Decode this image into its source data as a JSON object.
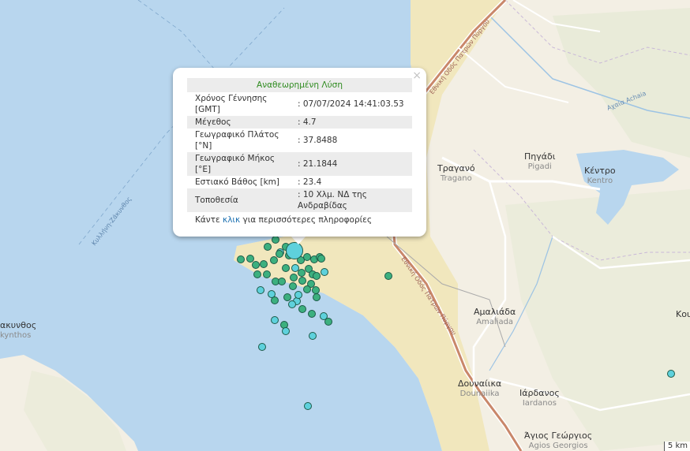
{
  "colors": {
    "sea": "#b8d6ee",
    "land": "#f3efe4",
    "plain": "#f1e7bd",
    "road": "#c9876a",
    "quake_green": "#3cb07f",
    "quake_cyan": "#5ed1dc",
    "popup_title": "#2e8b1f",
    "link": "#1a6fb0"
  },
  "popup": {
    "title": "Αναθεωρημένη Λύση",
    "close": "×",
    "rows": [
      {
        "label": "Χρόνος Γέννησης [GMT]",
        "value": ": 07/07/2024 14:41:03.53"
      },
      {
        "label": "Μέγεθος",
        "value": ": 4.7"
      },
      {
        "label": "Γεωγραφικό Πλάτος [°N]",
        "value": ": 37.8488"
      },
      {
        "label": "Γεωγραφικό Μήκος [°E]",
        "value": ": 21.1844"
      },
      {
        "label": "Εστιακό Βάθος [km]",
        "value": ": 23.4"
      },
      {
        "label": "Τοποθεσία",
        "value": ": 10 Χλμ. ΝΔ της Ανδραβίδας"
      }
    ],
    "more_prefix": "Κάντε",
    "more_link": "κλικ",
    "more_suffix": "για περισσότερες πληροφορίες"
  },
  "places": [
    {
      "name": "Τραγανό",
      "latin": "Tragano"
    },
    {
      "name": "Πηγάδι",
      "latin": "Pigadi"
    },
    {
      "name": "Κέντρο",
      "latin": "Kentro"
    },
    {
      "name": "Αμαλιάδα",
      "latin": "Amaliada"
    },
    {
      "name": "Δουναίικα",
      "latin": "Dounaiika"
    },
    {
      "name": "Ιάρδανος",
      "latin": "Iardanos"
    },
    {
      "name": "Άγιος Γεώργιος",
      "latin": "Agios Georgios"
    },
    {
      "name": "ακυνθος",
      "latin": "kynthos"
    },
    {
      "name": "Κου",
      "latin": ""
    }
  ],
  "sea_routes": [
    {
      "label": "Κυλλήνη-Ζάκυνθος"
    },
    {
      "label": "Κυλλήνη-Ζάκυνθος"
    }
  ],
  "road_labels": [
    {
      "label": "Εθνική Οδός Πατρών Πύργου"
    },
    {
      "label": "Εθνική Οδός Πατρών Πύργου"
    }
  ],
  "river_label": "Αχαία Achaia",
  "scale_label": "5 km"
}
